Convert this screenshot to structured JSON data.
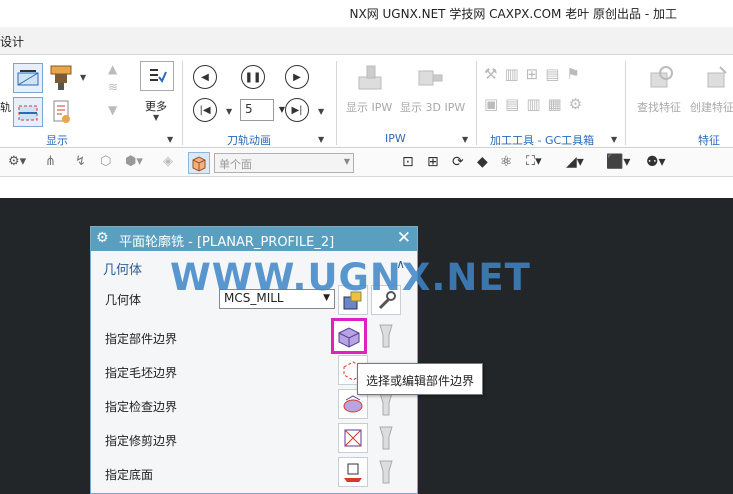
{
  "window": {
    "title": "NX网 UGNX.NET 学技网 CAXPX.COM 老叶 原创出品 - 加工"
  },
  "ribbon_tab": {
    "label": "设计"
  },
  "ribbon": {
    "left_cut_label": "轨",
    "display_group": {
      "label": "显示",
      "more_label": "更多"
    },
    "animation_group": {
      "label": "刀轨动画",
      "frame_value": "5"
    },
    "ipw_group": {
      "label": "IPW",
      "show_ipw": "显示 IPW",
      "show_3d_ipw": "显示 3D IPW"
    },
    "tools_group": {
      "label": "加工工具 - GC工具箱"
    },
    "feature_group": {
      "label": "特征",
      "find_feature": "查找特征",
      "create_feature": "创建特征"
    }
  },
  "toolbar": {
    "selection_filter_value": "单个面"
  },
  "dialog": {
    "title": "平面轮廓铣 - [PLANAR_PROFILE_2]",
    "section_label": "几何体",
    "geometry_label": "几何体",
    "geometry_value": "MCS_MILL",
    "rows": [
      {
        "label": "指定部件边界"
      },
      {
        "label": "指定毛坯边界"
      },
      {
        "label": "指定检查边界"
      },
      {
        "label": "指定修剪边界"
      },
      {
        "label": "指定底面"
      }
    ],
    "tooltip": "选择或编辑部件边界"
  },
  "watermark": {
    "text": "WWW.UGNX.NET",
    "color": "#3f86c8"
  },
  "colors": {
    "dialog_title_bg": "#5a9fc0",
    "graphics_bg": "#232629",
    "highlight": "#e020c0",
    "group_label": "#2a6ab8"
  }
}
